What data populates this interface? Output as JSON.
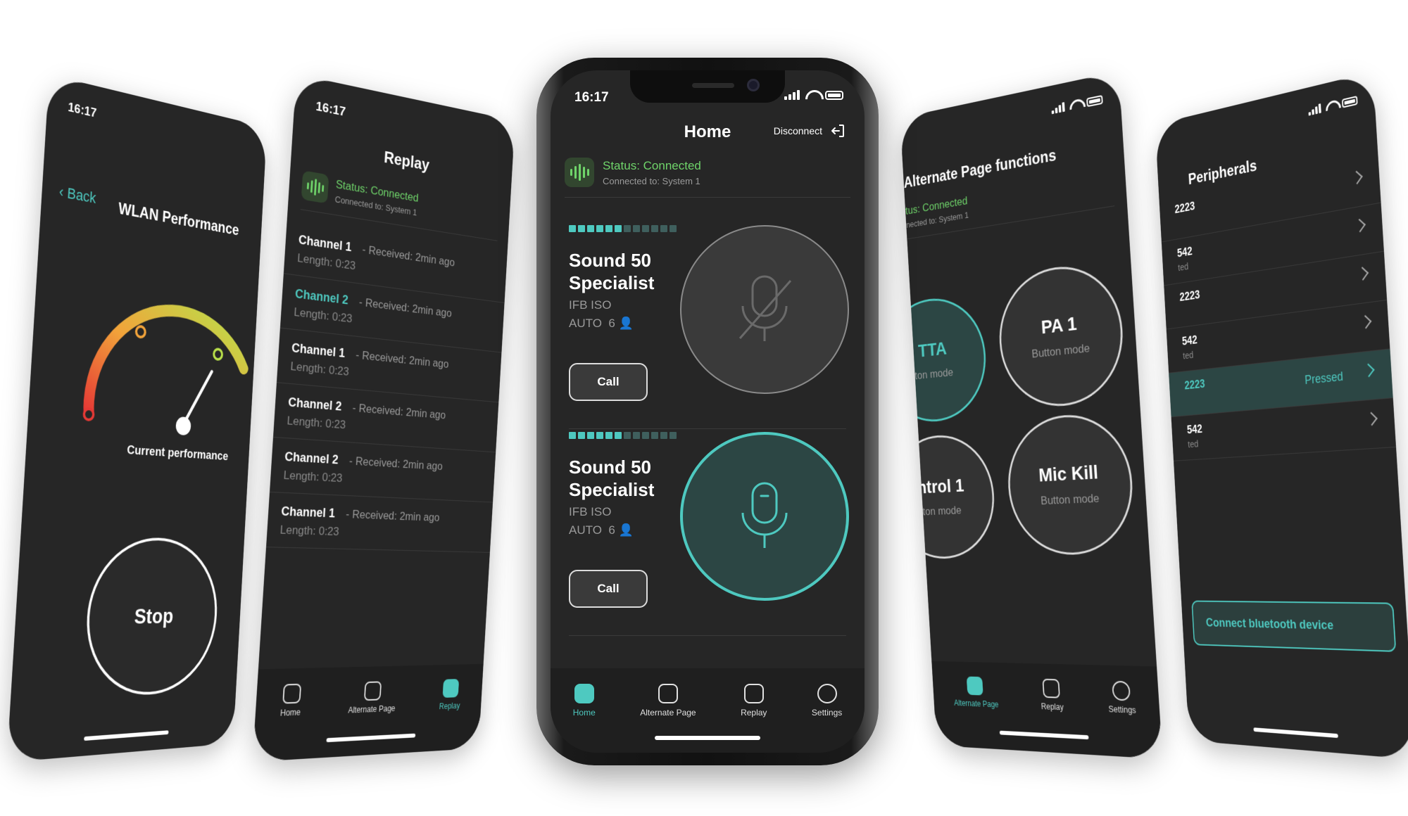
{
  "status_time": "16:17",
  "colors": {
    "accent": "#4ec9c0",
    "connected": "#6fd46a",
    "background": "#262626"
  },
  "wlan": {
    "back_label": "Back",
    "title": "WLAN Performance",
    "gauge_caption": "Current performance",
    "stop_label": "Stop"
  },
  "replay": {
    "title": "Replay",
    "status": "Status: Connected",
    "connected_to": "Connected to: System 1",
    "items": [
      {
        "channel": "Channel 1",
        "received": "- Received: 2min ago",
        "length": "Length: 0:23",
        "selected": false
      },
      {
        "channel": "Channel 2",
        "received": "- Received: 2min ago",
        "length": "Length: 0:23",
        "selected": true
      },
      {
        "channel": "Channel 1",
        "received": "- Received: 2min ago",
        "length": "Length: 0:23",
        "selected": false
      },
      {
        "channel": "Channel 2",
        "received": "- Received: 2min ago",
        "length": "Length: 0:23",
        "selected": false
      },
      {
        "channel": "Channel 2",
        "received": "- Received: 2min ago",
        "length": "Length: 0:23",
        "selected": false
      },
      {
        "channel": "Channel 1",
        "received": "- Received: 2min ago",
        "length": "Length: 0:23",
        "selected": false
      }
    ],
    "tabs": [
      "Home",
      "Alternate Page",
      "Replay"
    ]
  },
  "home": {
    "title": "Home",
    "disconnect_label": "Disconnect",
    "status": "Status: Connected",
    "connected_to": "Connected to: System 1",
    "devices": [
      {
        "name_line1": "Sound 50",
        "name_line2": "Specialist",
        "type": "IFB ISO",
        "mode": "AUTO",
        "users": "6",
        "call_label": "Call",
        "mic_active": false
      },
      {
        "name_line1": "Sound 50",
        "name_line2": "Specialist",
        "type": "IFB ISO",
        "mode": "AUTO",
        "users": "6",
        "call_label": "Call",
        "mic_active": true
      }
    ],
    "tabs": [
      "Home",
      "Alternate Page",
      "Replay",
      "Settings"
    ]
  },
  "alternate": {
    "title": "Alternate Page functions",
    "status": "tus: Connected",
    "connected_to": "nected to: System 1",
    "buttons": [
      {
        "label": "TTA",
        "sub": "ton mode",
        "active": true
      },
      {
        "label": "PA 1",
        "sub": "Button mode",
        "active": false
      },
      {
        "label": "ntrol 1",
        "sub": "ton mode",
        "active": false
      },
      {
        "label": "Mic Kill",
        "sub": "Button mode",
        "active": false
      }
    ],
    "tabs": [
      "Alternate Page",
      "Replay",
      "Settings"
    ]
  },
  "peripherals": {
    "title": "Peripherals",
    "rows": [
      {
        "id": "2223",
        "status": ""
      },
      {
        "id": "542",
        "status": "ted"
      },
      {
        "id": "2223",
        "status": ""
      },
      {
        "id": "542",
        "status": "ted"
      },
      {
        "id": "2223",
        "status": "",
        "pressed_label": "Pressed"
      },
      {
        "id": "542",
        "status": "ted"
      }
    ],
    "connect_label": "Connect bluetooth device"
  }
}
